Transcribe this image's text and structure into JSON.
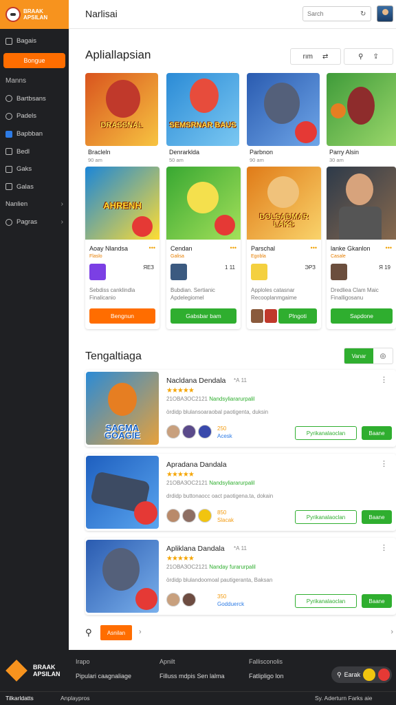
{
  "brand": {
    "logo_text": "BRAAK APSILAN"
  },
  "sidebar": {
    "items_top": [
      {
        "label": "Bagais",
        "icon": "grid-icon"
      }
    ],
    "active": "Bongue",
    "heading1": "Manns",
    "items_mid": [
      {
        "label": "Bartbsans",
        "icon": "home-icon"
      },
      {
        "label": "Padels",
        "icon": "gamepad-icon"
      },
      {
        "label": "Bapbban",
        "icon": "checkbox-icon"
      },
      {
        "label": "Bedl",
        "icon": "bag-icon"
      },
      {
        "label": "Gaks",
        "icon": "folder-icon"
      },
      {
        "label": "Galas",
        "icon": "image-icon"
      }
    ],
    "expand_items": [
      {
        "label": "Nanlien"
      },
      {
        "label": "Pagras"
      }
    ]
  },
  "header": {
    "title": "Narlisai",
    "search_placeholder": "Sarch"
  },
  "section1": {
    "title": "Apliallapsian",
    "tool_a": "rım",
    "tool_b": "⇄"
  },
  "featured": [
    {
      "title": "Bracleln",
      "sub": "90 am",
      "art_text": "DRASSNAL",
      "colors": [
        "#d9541e",
        "#f7c441"
      ]
    },
    {
      "title": "Denrarklda",
      "sub": "50 am",
      "art_text": "SEMSRNAR BAUS",
      "colors": [
        "#2b8bd6",
        "#7bc8f2"
      ]
    },
    {
      "title": "Parbnon",
      "sub": "90 am",
      "art_text": "",
      "colors": [
        "#2a5bb0",
        "#6fa6e8"
      ]
    },
    {
      "title": "Parry Alsin",
      "sub": "30 am",
      "art_text": "",
      "colors": [
        "#3f9b3a",
        "#9cd86b"
      ]
    }
  ],
  "apps": [
    {
      "name": "Aoay Nlandsa",
      "category": "Flaslo",
      "count": "ЯЕЗ",
      "desc": "Sebdiss canklindla Finalicanio",
      "button": "Bengnun",
      "btn_color": "#ff6d00",
      "art_text": "AHRENH",
      "colors": [
        "#1b86d8",
        "#ffdd33"
      ]
    },
    {
      "name": "Cendan",
      "category": "Galisa",
      "count": "1 11",
      "desc": "Bubdian. Sertianic Apdelegiomel",
      "button": "Gabsbar bam",
      "btn_color": "#2fae2f",
      "art_text": "",
      "colors": [
        "#38a832",
        "#a4e05a"
      ]
    },
    {
      "name": "Parschal",
      "category": "Egobla",
      "count": "ЭРЗ",
      "desc": "Apploles catasnar Recooplanmgaime",
      "button": "Plngoti",
      "btn_color": "#2fae2f",
      "art_text": "DOLSADMAR LAKS",
      "colors": [
        "#e07b18",
        "#f9d36b"
      ]
    },
    {
      "name": "lanke Gkanlon",
      "category": "Casale",
      "count": "Я 19",
      "desc": "Dredliea Clam Maic Finalligosanu",
      "button": "Sapdone",
      "btn_color": "#2fae2f",
      "art_text": "",
      "colors": [
        "#2d3a4a",
        "#8a6a4d"
      ]
    }
  ],
  "section2": {
    "title": "Tengaltiaga",
    "toggle_on": "Vanar",
    "toggle_off": "◎"
  },
  "list": [
    {
      "name": "Nacldana Dendala",
      "tag": "*А 11",
      "stars": "★★★★★",
      "meta_id": "21ОВАЗОС2121",
      "meta_link": "Nandsyliararurpalil",
      "desc": "ördidp blulansoaraobal paotigenta, duksin",
      "stat_num": "250",
      "stat_text": "Acesk",
      "stat_color": "#f39c12",
      "btn_outline": "Pyrikanalaoclan",
      "btn_solid": "Baane",
      "art_text": "SAGMA GOAGIE",
      "colors": [
        "#2b8bd6",
        "#e7a13b"
      ]
    },
    {
      "name": "Apradana Dandala",
      "tag": "*А 11",
      "stars": "★★★★★",
      "meta_id": "21ОВАЗОС2121",
      "meta_link": "Nandsyliararurpalil",
      "desc": "drdidp buttonaocc oact paotigena.ta, dokain",
      "stat_num": "850",
      "stat_text": "Slacak",
      "stat_color": "#f39c12",
      "btn_outline": "Pyrikanalaoclan",
      "btn_solid": "Baane",
      "art_text": "",
      "colors": [
        "#1e5fbf",
        "#5aa5ef"
      ]
    },
    {
      "name": "Apliklana Dandala",
      "tag": "*А 11",
      "stars": "★★★★★",
      "meta_id": "21ОВАЗОС2121",
      "meta_link": "Nanday furarurpalil",
      "desc": "ördidp blulandoomoal pautigeranta, Baksan",
      "stat_num": "350",
      "stat_text": "Godduerck",
      "stat_color": "#2d7be5",
      "btn_outline": "Pyrikanalaoclan",
      "btn_solid": "Baane",
      "art_text": "",
      "colors": [
        "#2a5bb0",
        "#7ab0ec"
      ]
    }
  ],
  "pager": {
    "button": "Asnilan",
    "next": "›",
    "right": "›"
  },
  "footer": {
    "brand": "BRAAK APSILAN",
    "cols": [
      {
        "head": "Irapo",
        "text": "Pipulari caagnaliage"
      },
      {
        "head": "Apnilt",
        "text": "Filluss mdpis Sen lalma"
      },
      {
        "head": "Fallisconolis",
        "text": "Fatlipligo lon"
      }
    ],
    "search": "Earak",
    "bottom_left": "Tilkarldatts",
    "bottom_mid": "Anplaypros",
    "bottom_right": "Sy. Aderturn  Farks aie"
  }
}
